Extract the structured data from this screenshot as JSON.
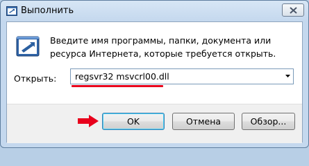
{
  "window": {
    "title": "Выполнить"
  },
  "icons": {
    "title": "run-icon",
    "dialog": "run-icon",
    "close": "close-icon",
    "dropdown": "chevron-down-icon",
    "annotation": "red-arrow-icon"
  },
  "dialog": {
    "description": "Введите имя программы, папки, документа или ресурса Интернета, которые требуется открыть.",
    "open_label": "Открыть:",
    "open_value": "regsvr32 msvcrl00.dll"
  },
  "buttons": {
    "ok": "OK",
    "cancel": "Отмена",
    "browse": "Обзор..."
  },
  "colors": {
    "annotation": "#e8001c"
  }
}
